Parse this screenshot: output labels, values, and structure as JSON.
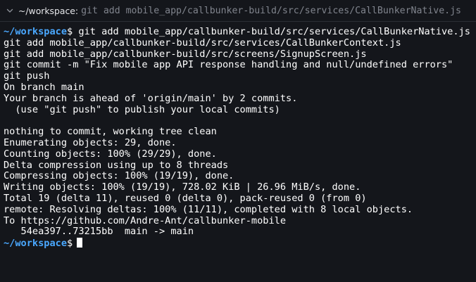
{
  "titlebar": {
    "cwd": "~/workspace:",
    "command": "git add mobile_app/callbunker-build/src/services/CallBunkerNative.js",
    "icon": "chevron-down-icon"
  },
  "prompt": {
    "path": "~/workspace",
    "symbol": "$",
    "color": "#4aa8ff"
  },
  "lines": [
    {
      "prompt": true,
      "text": " git add mobile_app/callbunker-build/src/services/CallBunkerNative.js"
    },
    {
      "prompt": false,
      "text": "git add mobile_app/callbunker-build/src/services/CallBunkerContext.js"
    },
    {
      "prompt": false,
      "text": "git add mobile_app/callbunker-build/src/screens/SignupScreen.js"
    },
    {
      "prompt": false,
      "text": "git commit -m \"Fix mobile app API response handling and null/undefined errors\""
    },
    {
      "prompt": false,
      "text": "git push"
    },
    {
      "prompt": false,
      "text": "On branch main"
    },
    {
      "prompt": false,
      "text": "Your branch is ahead of 'origin/main' by 2 commits."
    },
    {
      "prompt": false,
      "text": "  (use \"git push\" to publish your local commits)"
    },
    {
      "prompt": false,
      "text": ""
    },
    {
      "prompt": false,
      "text": "nothing to commit, working tree clean"
    },
    {
      "prompt": false,
      "text": "Enumerating objects: 29, done."
    },
    {
      "prompt": false,
      "text": "Counting objects: 100% (29/29), done."
    },
    {
      "prompt": false,
      "text": "Delta compression using up to 8 threads"
    },
    {
      "prompt": false,
      "text": "Compressing objects: 100% (19/19), done."
    },
    {
      "prompt": false,
      "text": "Writing objects: 100% (19/19), 728.02 KiB | 26.96 MiB/s, done."
    },
    {
      "prompt": false,
      "text": "Total 19 (delta 11), reused 0 (delta 0), pack-reused 0 (from 0)"
    },
    {
      "prompt": false,
      "text": "remote: Resolving deltas: 100% (11/11), completed with 8 local objects."
    },
    {
      "prompt": false,
      "text": "To https://github.com/Andre-Ant/callbunker-mobile"
    },
    {
      "prompt": false,
      "text": "   54ea397..73215bb  main -> main"
    },
    {
      "prompt": true,
      "text": "",
      "cursor": true
    }
  ]
}
